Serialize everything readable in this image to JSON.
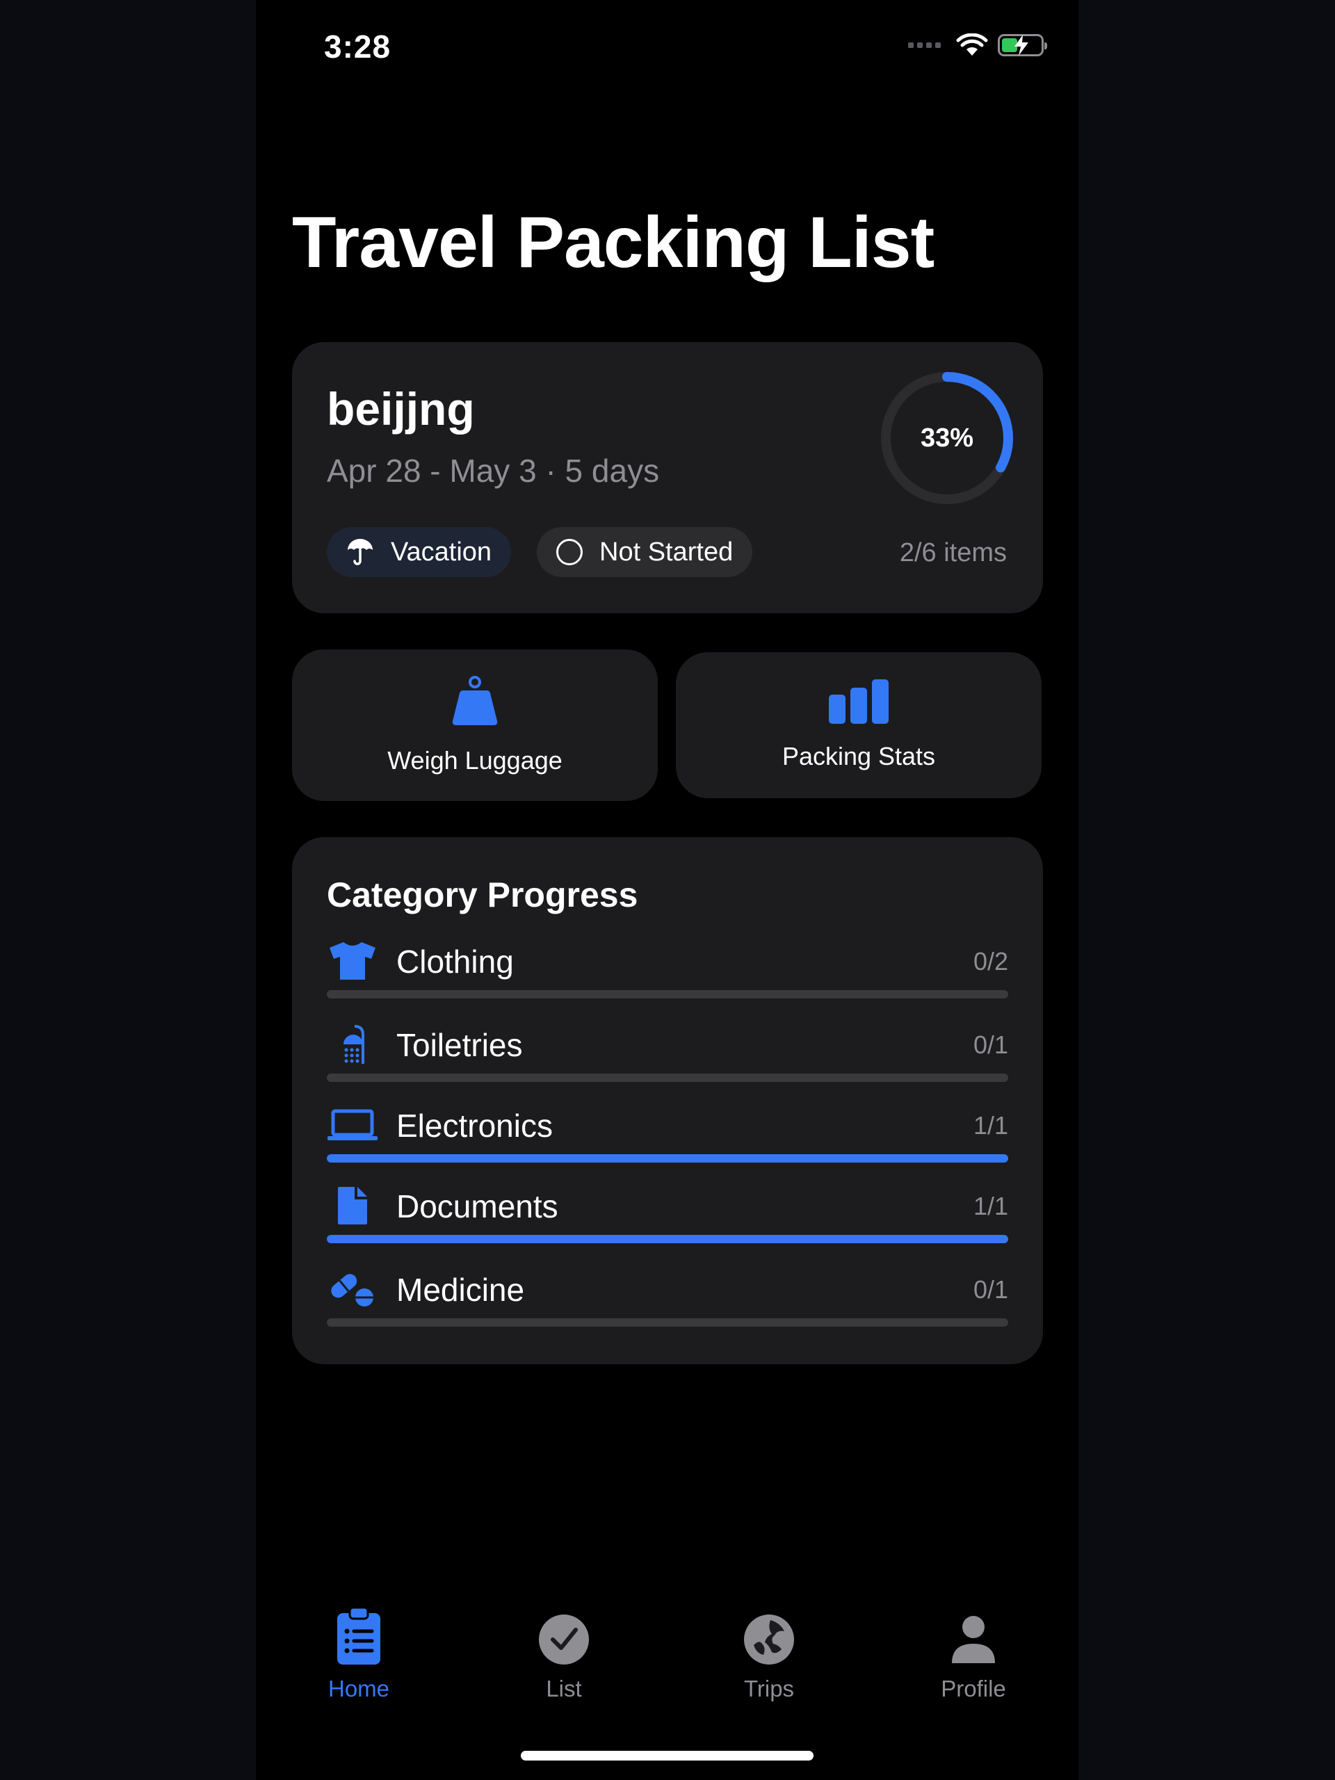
{
  "status_bar": {
    "time": "3:28"
  },
  "page": {
    "title": "Travel Packing List"
  },
  "trip": {
    "name": "beijjng",
    "dates": "Apr 28 - May 3 · 5 days",
    "type_label": "Vacation",
    "status_label": "Not Started",
    "progress_label": "33%",
    "progress_fraction": 0.33,
    "items_label": "2/6 items"
  },
  "actions": {
    "weigh_label": "Weigh Luggage",
    "stats_label": "Packing Stats"
  },
  "categories": {
    "title": "Category Progress",
    "items": [
      {
        "name": "Clothing",
        "count": "0/2",
        "progress": 0,
        "icon": "tshirt-icon"
      },
      {
        "name": "Toiletries",
        "count": "0/1",
        "progress": 0,
        "icon": "shower-icon"
      },
      {
        "name": "Electronics",
        "count": "1/1",
        "progress": 1,
        "icon": "laptop-icon"
      },
      {
        "name": "Documents",
        "count": "1/1",
        "progress": 1,
        "icon": "document-icon"
      },
      {
        "name": "Medicine",
        "count": "0/1",
        "progress": 0,
        "icon": "pills-icon"
      }
    ]
  },
  "tabs": [
    {
      "label": "Home",
      "icon": "clipboard-icon",
      "active": true
    },
    {
      "label": "List",
      "icon": "checkmark-circle-icon",
      "active": false
    },
    {
      "label": "Trips",
      "icon": "globe-icon",
      "active": false
    },
    {
      "label": "Profile",
      "icon": "person-icon",
      "active": false
    }
  ],
  "colors": {
    "accent": "#3478f6",
    "card": "#1c1c1e",
    "background": "#000000",
    "secondary_text": "#8e8e93",
    "battery": "#34c759"
  }
}
